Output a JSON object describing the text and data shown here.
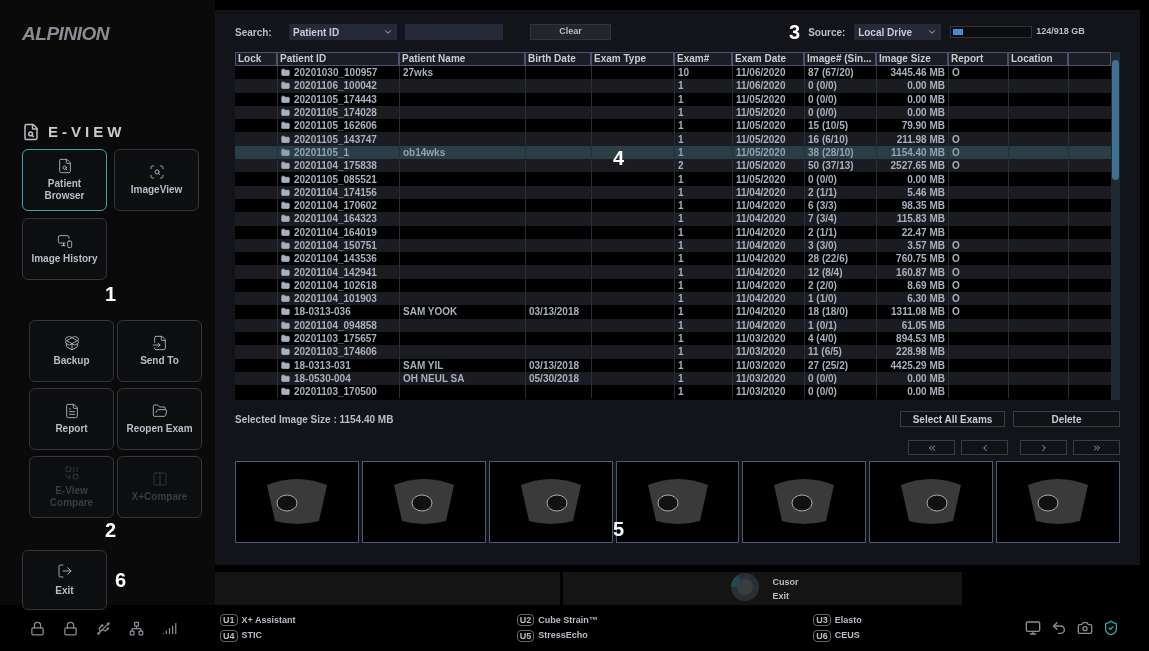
{
  "sidebar": {
    "logo": "ALPINION",
    "title": "E-VIEW",
    "view_buttons": [
      {
        "kind": "browser",
        "label": "Patient Browser",
        "selected": true,
        "disabled": false
      },
      {
        "kind": "imageview",
        "label": "ImageView",
        "selected": false,
        "disabled": false
      },
      {
        "kind": "history",
        "label": "Image History",
        "selected": false,
        "disabled": false
      }
    ],
    "callout_1": "1",
    "action_buttons": [
      {
        "kind": "backup",
        "label": "Backup",
        "disabled": false
      },
      {
        "kind": "sendto",
        "label": "Send To",
        "disabled": false
      },
      {
        "kind": "report",
        "label": "Report",
        "disabled": false
      },
      {
        "kind": "reopen",
        "label": "Reopen Exam",
        "disabled": false
      },
      {
        "kind": "compare",
        "label": "E-View Compare",
        "disabled": true
      },
      {
        "kind": "xcompare",
        "label": "X+Compare",
        "disabled": true
      }
    ],
    "callout_2": "2",
    "exit_button": {
      "label": "Exit"
    },
    "callout_6": "6"
  },
  "toolbar": {
    "search_label": "Search:",
    "search_by": "Patient ID",
    "clear_button": "Clear",
    "callout_3": "3",
    "source_label": "Source:",
    "source": "Local Drive",
    "storage": {
      "level": 0.135,
      "reading": "124/918 GB"
    }
  },
  "table": {
    "columns": [
      "Lock",
      "Patient ID",
      "Patient Name",
      "Birth Date",
      "Exam Type",
      "Exam#",
      "Exam Date",
      "Image# (Sin...",
      "Image Size",
      "Report",
      "Location"
    ],
    "callout_4": "4",
    "rows": [
      {
        "id": "20201030_100957",
        "name": "27wks",
        "birth": "",
        "exams": "10",
        "date": "11/06/2020",
        "images": "87 (67/20)",
        "size": "3445.46 MB",
        "report": "O",
        "selected": false
      },
      {
        "id": "20201106_100042",
        "name": "",
        "birth": "",
        "exams": "1",
        "date": "11/06/2020",
        "images": "0 (0/0)",
        "size": "0.00 MB",
        "report": "",
        "selected": false
      },
      {
        "id": "20201105_174443",
        "name": "",
        "birth": "",
        "exams": "1",
        "date": "11/05/2020",
        "images": "0 (0/0)",
        "size": "0.00 MB",
        "report": "",
        "selected": false
      },
      {
        "id": "20201105_174028",
        "name": "",
        "birth": "",
        "exams": "1",
        "date": "11/05/2020",
        "images": "0 (0/0)",
        "size": "0.00 MB",
        "report": "",
        "selected": false
      },
      {
        "id": "20201105_162606",
        "name": "",
        "birth": "",
        "exams": "1",
        "date": "11/05/2020",
        "images": "15 (10/5)",
        "size": "79.90 MB",
        "report": "",
        "selected": false
      },
      {
        "id": "20201105_143747",
        "name": "",
        "birth": "",
        "exams": "1",
        "date": "11/05/2020",
        "images": "16 (6/10)",
        "size": "211.98 MB",
        "report": "O",
        "selected": false
      },
      {
        "id": "20201105_1",
        "name": "ob14wks",
        "birth": "",
        "exams": "1",
        "date": "11/05/2020",
        "images": "38 (28/10)",
        "size": "1154.40 MB",
        "report": "O",
        "selected": true
      },
      {
        "id": "20201104_175838",
        "name": "",
        "birth": "",
        "exams": "2",
        "date": "11/05/2020",
        "images": "50 (37/13)",
        "size": "2527.65 MB",
        "report": "O",
        "selected": false
      },
      {
        "id": "20201105_085521",
        "name": "",
        "birth": "",
        "exams": "1",
        "date": "11/05/2020",
        "images": "0 (0/0)",
        "size": "0.00 MB",
        "report": "",
        "selected": false
      },
      {
        "id": "20201104_174156",
        "name": "",
        "birth": "",
        "exams": "1",
        "date": "11/04/2020",
        "images": "2 (1/1)",
        "size": "5.46 MB",
        "report": "",
        "selected": false
      },
      {
        "id": "20201104_170602",
        "name": "",
        "birth": "",
        "exams": "1",
        "date": "11/04/2020",
        "images": "6 (3/3)",
        "size": "98.35 MB",
        "report": "",
        "selected": false
      },
      {
        "id": "20201104_164323",
        "name": "",
        "birth": "",
        "exams": "1",
        "date": "11/04/2020",
        "images": "7 (3/4)",
        "size": "115.83 MB",
        "report": "",
        "selected": false
      },
      {
        "id": "20201104_164019",
        "name": "",
        "birth": "",
        "exams": "1",
        "date": "11/04/2020",
        "images": "2 (1/1)",
        "size": "22.47 MB",
        "report": "",
        "selected": false
      },
      {
        "id": "20201104_150751",
        "name": "",
        "birth": "",
        "exams": "1",
        "date": "11/04/2020",
        "images": "3 (3/0)",
        "size": "3.57 MB",
        "report": "O",
        "selected": false
      },
      {
        "id": "20201104_143536",
        "name": "",
        "birth": "",
        "exams": "1",
        "date": "11/04/2020",
        "images": "28 (22/6)",
        "size": "760.75 MB",
        "report": "O",
        "selected": false
      },
      {
        "id": "20201104_142941",
        "name": "",
        "birth": "",
        "exams": "1",
        "date": "11/04/2020",
        "images": "12 (8/4)",
        "size": "160.87 MB",
        "report": "O",
        "selected": false
      },
      {
        "id": "20201104_102618",
        "name": "",
        "birth": "",
        "exams": "1",
        "date": "11/04/2020",
        "images": "2 (2/0)",
        "size": "8.69 MB",
        "report": "O",
        "selected": false
      },
      {
        "id": "20201104_101903",
        "name": "",
        "birth": "",
        "exams": "1",
        "date": "11/04/2020",
        "images": "1 (1/0)",
        "size": "6.30 MB",
        "report": "O",
        "selected": false
      },
      {
        "id": "18-0313-036",
        "name": "SAM YOOK",
        "birth": "03/13/2018",
        "exams": "1",
        "date": "11/04/2020",
        "images": "18 (18/0)",
        "size": "1311.08 MB",
        "report": "O",
        "selected": false
      },
      {
        "id": "20201104_094858",
        "name": "",
        "birth": "",
        "exams": "1",
        "date": "11/04/2020",
        "images": "1 (0/1)",
        "size": "61.05 MB",
        "report": "",
        "selected": false
      },
      {
        "id": "20201103_175657",
        "name": "",
        "birth": "",
        "exams": "1",
        "date": "11/03/2020",
        "images": "4 (4/0)",
        "size": "894.53 MB",
        "report": "",
        "selected": false
      },
      {
        "id": "20201103_174606",
        "name": "",
        "birth": "",
        "exams": "1",
        "date": "11/03/2020",
        "images": "11 (6/5)",
        "size": "228.98 MB",
        "report": "",
        "selected": false
      },
      {
        "id": "18-0313-031",
        "name": "SAM YIL",
        "birth": "03/13/2018",
        "exams": "1",
        "date": "11/03/2020",
        "images": "27 (25/2)",
        "size": "4425.29 MB",
        "report": "",
        "selected": false
      },
      {
        "id": "18-0530-004",
        "name": "OH NEUL SA",
        "birth": "05/30/2018",
        "exams": "1",
        "date": "11/03/2020",
        "images": "0 (0/0)",
        "size": "0.00 MB",
        "report": "",
        "selected": false
      },
      {
        "id": "20201103_170500",
        "name": "",
        "birth": "",
        "exams": "1",
        "date": "11/03/2020",
        "images": "0 (0/0)",
        "size": "0.00 MB",
        "report": "",
        "selected": false
      }
    ]
  },
  "selection": {
    "summary": "Selected Image Size : 1154.40 MB",
    "select_all_button": "Select All Exams",
    "delete_button": "Delete"
  },
  "thumbnails": {
    "images": [
      {
        "kind": "ultrasound"
      },
      {
        "kind": "ultrasound"
      },
      {
        "kind": "ultrasound"
      },
      {
        "kind": "ultrasound"
      },
      {
        "kind": "ultrasound"
      },
      {
        "kind": "ultrasound"
      },
      {
        "kind": "ultrasound"
      }
    ],
    "callout_5": "5"
  },
  "trackball": {
    "top_label": "Cusor",
    "bottom_label": "Exit"
  },
  "user_keys": [
    {
      "key": "U1",
      "label": "X+ Assistant"
    },
    {
      "key": "U2",
      "label": "Cube Strain™"
    },
    {
      "key": "U3",
      "label": "Elasto"
    },
    {
      "key": "U4",
      "label": "STIC"
    },
    {
      "key": "U5",
      "label": "StressEcho"
    },
    {
      "key": "U6",
      "label": "CEUS"
    }
  ]
}
